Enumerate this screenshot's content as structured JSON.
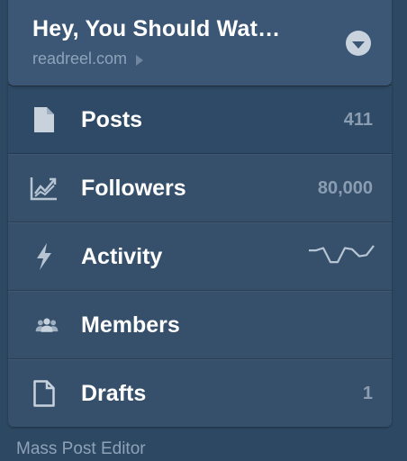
{
  "header": {
    "title": "Hey, You Should Wat…",
    "url": "readreel.com",
    "url_arrow_icon": "right-triangle-icon",
    "dropdown_icon": "chevron-down-circle-icon"
  },
  "menu": {
    "items": [
      {
        "label": "Posts",
        "count": "411",
        "icon": "page-icon",
        "selected": true
      },
      {
        "label": "Followers",
        "count": "80,000",
        "icon": "trend-chart-icon"
      },
      {
        "label": "Activity",
        "count": "",
        "icon": "lightning-icon",
        "sparkline": [
          0.35,
          0.35,
          0.25,
          0.85,
          0.85,
          0.25,
          0.3,
          0.6,
          0.55,
          0.15
        ]
      },
      {
        "label": "Members",
        "count": "",
        "icon": "people-icon"
      },
      {
        "label": "Drafts",
        "count": "1",
        "icon": "blank-page-icon"
      }
    ]
  },
  "footer": {
    "link": "Mass Post Editor"
  },
  "colors": {
    "background": "#2d4862",
    "panel": "#36506c",
    "header": "#3b5775",
    "text_primary": "#ffffff",
    "text_muted": "#8a9db1"
  }
}
